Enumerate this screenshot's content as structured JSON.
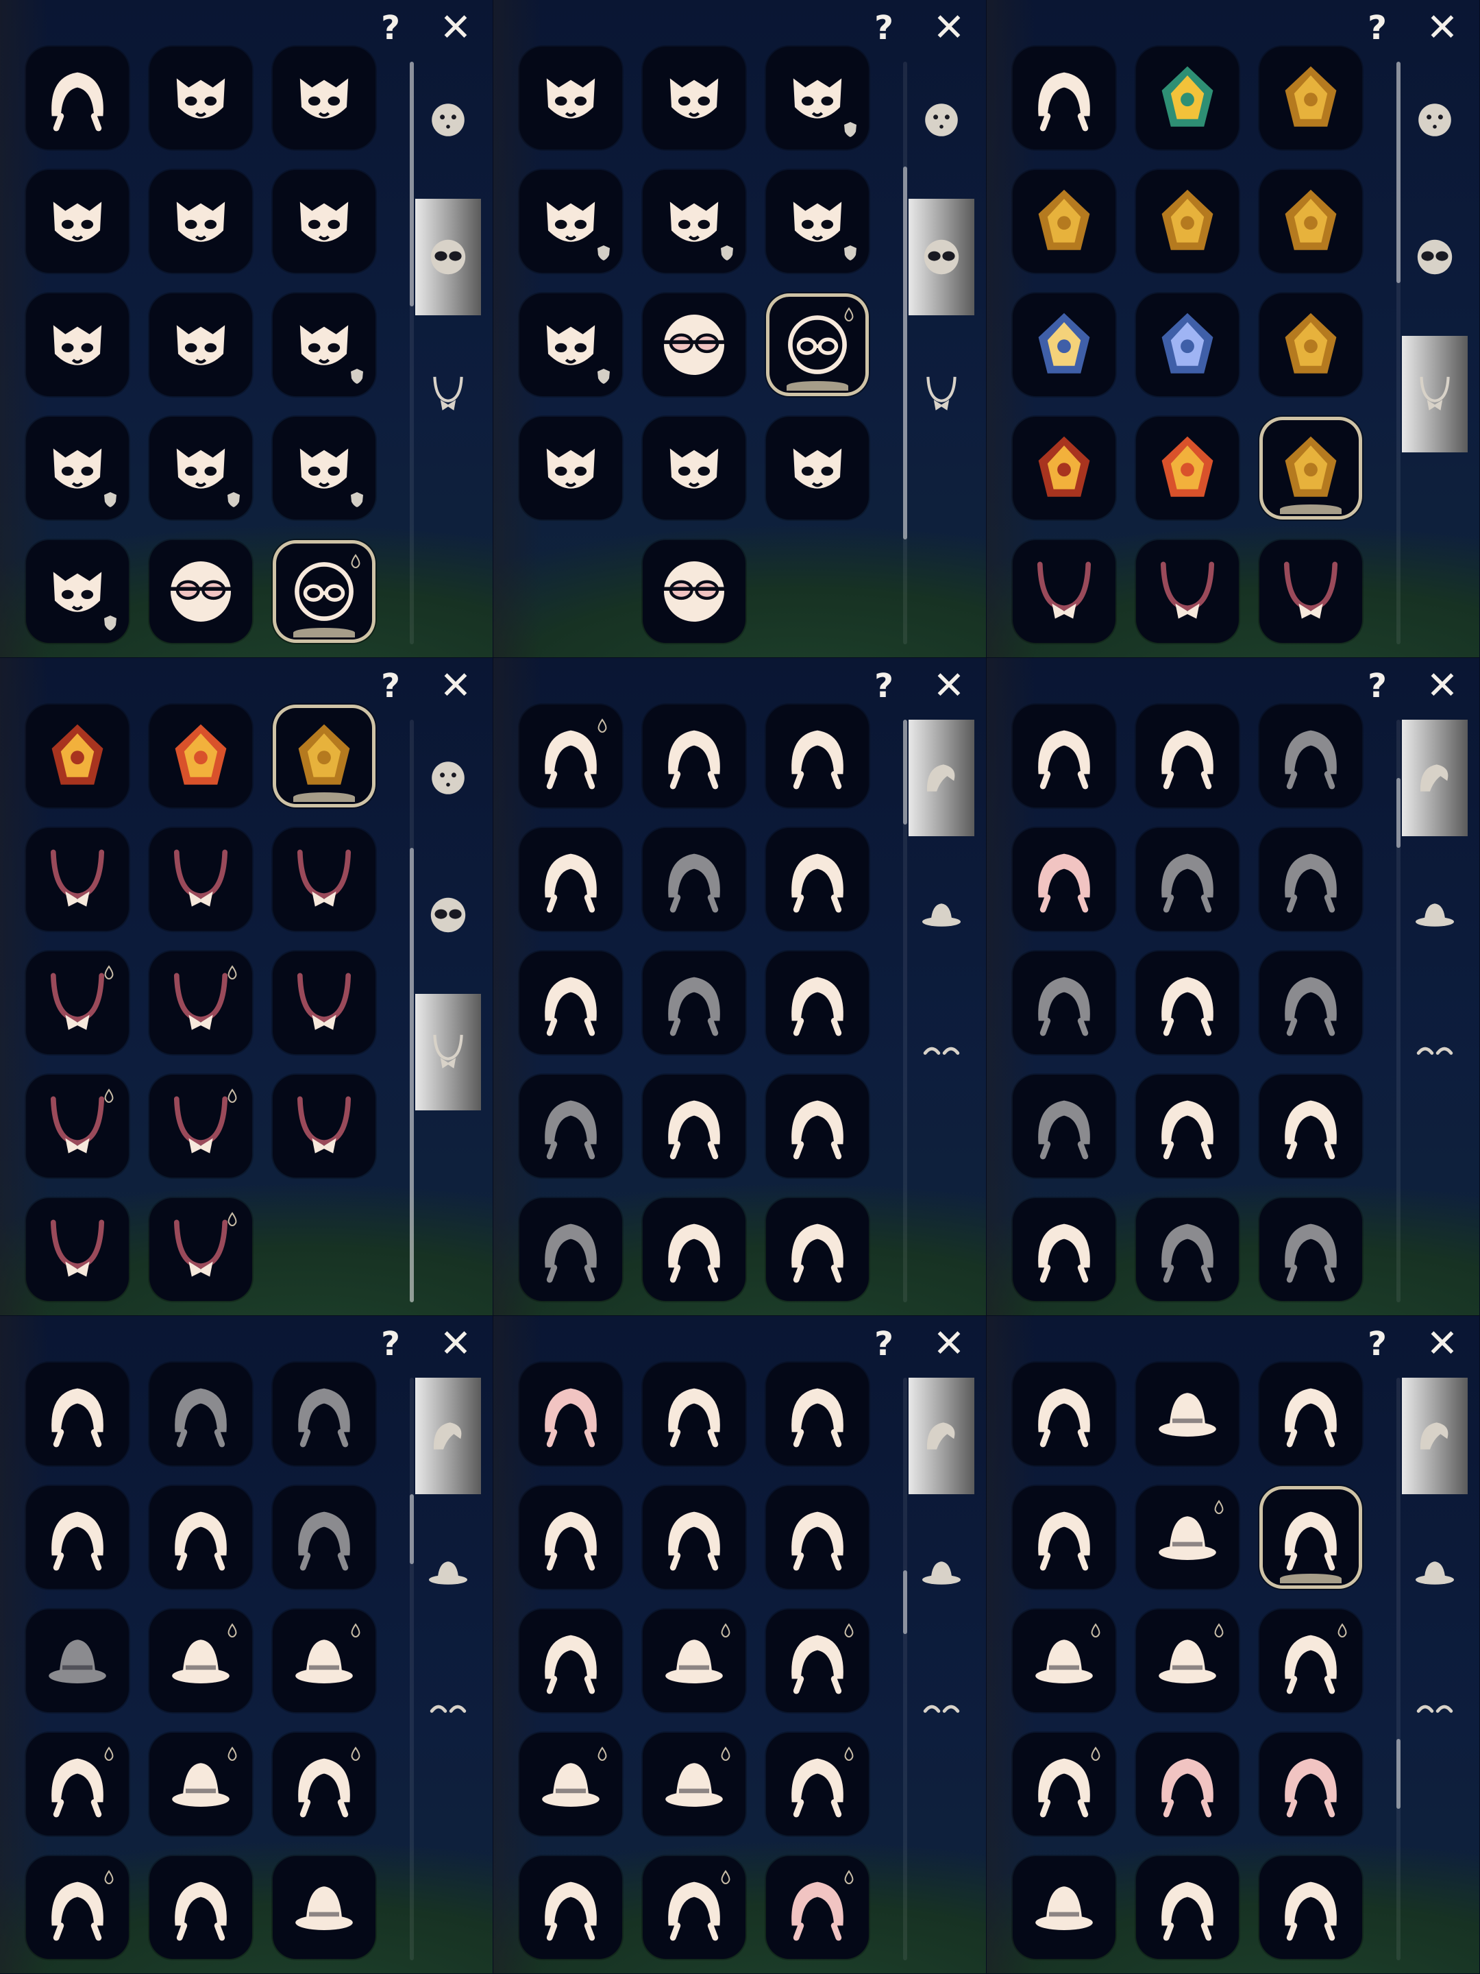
{
  "ui": {
    "help_label": "?",
    "close_label": "✕"
  },
  "colors": {
    "cream": "#f7e9dc",
    "pink": "#f1c4c2",
    "dark_pink": "#9a4a5a",
    "gray": "#8b8b8f",
    "gold": "#e7b23c",
    "gold_dark": "#b57a1f",
    "blue": "#3f5fa8",
    "red": "#a8341f",
    "cell_bg": "#040817",
    "selected_border": "#cfc3a6"
  },
  "panels": [
    {
      "id": "masks-1",
      "tabs": [
        "face-tab-icon",
        "mask-tab-icon",
        "necklace-tab-icon"
      ],
      "active_tab": 1,
      "scroll": [
        0.0,
        0.42
      ],
      "cells": [
        [
          "none-icon",
          "bull-mask-icon",
          "helmet-mask-icon"
        ],
        [
          "diamond-mask-icon",
          "horned-mask-icon",
          "horned-mask-icon"
        ],
        [
          "wolf-mask-icon",
          "helmet-mask-icon",
          "bull-mask-icon:locked"
        ],
        [
          "crown-mask-icon:locked",
          "diamond-mask-icon:locked",
          "spirit-mask-icon:locked"
        ],
        [
          "spirit-mask-icon:locked",
          "sunglasses-icon",
          "glasses-icon:selected:drop"
        ]
      ]
    },
    {
      "id": "masks-2",
      "tabs": [
        "face-tab-icon",
        "mask-tab-icon",
        "necklace-tab-icon"
      ],
      "active_tab": 1,
      "scroll": [
        0.18,
        0.82
      ],
      "cells": [
        [
          "wolf-mask-icon",
          "helmet-mask-icon",
          "bull-mask-icon:locked"
        ],
        [
          "crown-mask-icon:locked",
          "diamond-mask-icon:locked",
          "spirit-mask-icon:locked"
        ],
        [
          "spirit-mask-icon:locked",
          "sunglasses-icon",
          "glasses-icon:selected:drop"
        ],
        [
          "fox-mask-icon",
          "beard-mask-icon",
          "swirl-mask-icon"
        ],
        [
          "",
          "heart-glasses-icon",
          ""
        ]
      ]
    },
    {
      "id": "necklaces-1",
      "tabs": [
        "face-tab-icon",
        "mask-tab-icon",
        "necklace-tab-icon"
      ],
      "active_tab": 2,
      "scroll": [
        0.0,
        0.38
      ],
      "cells": [
        [
          "none-icon",
          "aquatic-crest-icon",
          "whirl-crest-icon"
        ],
        [
          "arch-crest-icon",
          "crystal-crest-icon",
          "wings-crest-icon"
        ],
        [
          "gem-crest-icon",
          "star-crest-icon",
          "mountain-crest-icon"
        ],
        [
          "flame-crest-icon",
          "bird-crest-icon",
          "sun-gear-crest-icon:selected"
        ],
        [
          "bow-necklace-icon",
          "tie-necklace-icon",
          "fish-necklace-icon"
        ]
      ]
    },
    {
      "id": "necklaces-2",
      "tabs": [
        "face-tab-icon",
        "mask-tab-icon",
        "necklace-tab-icon"
      ],
      "active_tab": 2,
      "scroll": [
        0.22,
        1.0
      ],
      "cells": [
        [
          "flame-crest-icon",
          "bird-crest-icon",
          "sun-gear-crest-icon:selected"
        ],
        [
          "bow-necklace-icon",
          "tie-necklace-icon",
          "fish-necklace-icon"
        ],
        [
          "scarf-necklace-icon:drop",
          "strap-necklace-icon:drop",
          "ruff-necklace-icon"
        ],
        [
          "bib-necklace-icon:drop",
          "flower-necklace-icon:drop",
          "turtle-necklace-icon"
        ],
        [
          "bell-necklace-icon",
          "pouch-necklace-icon:drop",
          ""
        ]
      ]
    },
    {
      "id": "hair-1",
      "tabs": [
        "hair-tab-icon",
        "hat-tab-icon",
        "horn-tab-icon"
      ],
      "active_tab": 0,
      "scroll": [
        0.0,
        0.18
      ],
      "cells": [
        [
          "ponytail-hair-icon:drop",
          "short-hair-icon",
          "pigtail-hair-icon"
        ],
        [
          "bun-hair-icon",
          "side-swept-hair-icon:gray",
          "bob-hair-icon"
        ],
        [
          "buns-hair-icon",
          "buns-hair-icon:gray",
          "bald-hair-icon"
        ],
        [
          "side-hair-icon:gray",
          "quiff-hair-icon",
          "spiky-hair-icon"
        ],
        [
          "long-hair-icon:gray",
          "braid-hair-icon",
          "bob-hair-icon"
        ]
      ]
    },
    {
      "id": "hair-2",
      "tabs": [
        "hair-tab-icon",
        "hat-tab-icon",
        "horn-tab-icon"
      ],
      "active_tab": 0,
      "scroll": [
        0.1,
        0.22
      ],
      "cells": [
        [
          "bowl-hair-icon",
          "long-straight-hair-icon",
          "spiky-hair-icon:gray"
        ],
        [
          "bowl-hair-icon:pink",
          "side-hair-icon:gray",
          "side-swept-hair-icon:gray"
        ],
        [
          "curly-hair-icon:gray",
          "long-hair-icon",
          "bowl-hair-icon:gray"
        ],
        [
          "long-hair-icon:gray",
          "spiky-hair-icon",
          "afro-hair-icon"
        ],
        [
          "afro-hair-icon",
          "bun-hair-icon:gray",
          "buns-hair-icon:gray"
        ]
      ]
    },
    {
      "id": "hair-3",
      "tabs": [
        "hair-tab-icon",
        "hat-tab-icon",
        "horn-tab-icon"
      ],
      "active_tab": 0,
      "scroll": [
        0.2,
        0.32
      ],
      "cells": [
        [
          "egg-hair-icon",
          "wing-hair-icon:gray",
          "long-hair-icon:gray"
        ],
        [
          "fish-hair-icon",
          "bob-hair-icon",
          "spiky-hair-icon:gray"
        ],
        [
          "hood-hair-icon:gray",
          "cone-hat-icon:drop",
          "saturn-hat-icon:drop"
        ],
        [
          "spiky-hair-icon:drop",
          "saucer-hat-icon:drop",
          "buns-hair-icon:drop"
        ],
        [
          "bob-hair-icon:drop",
          "braid-hair-icon",
          "turban-hat-icon"
        ]
      ]
    },
    {
      "id": "hair-4",
      "tabs": [
        "hair-tab-icon",
        "hat-tab-icon",
        "horn-tab-icon"
      ],
      "active_tab": 0,
      "scroll": [
        0.33,
        0.44
      ],
      "cells": [
        [
          "pigtail-hair-icon:pink",
          "long-hair-icon",
          "long-hair-icon"
        ],
        [
          "curly-hair-icon",
          "bowl-hair-icon",
          "ponytail-hair-icon"
        ],
        [
          "bob-hair-icon",
          "wide-brim-hat-icon:drop",
          "ponytail-hair-icon:drop"
        ],
        [
          "saucer-hat-icon:drop",
          "flower-crown-icon:drop",
          "palm-hair-icon:drop"
        ],
        [
          "short-hair-icon",
          "braid-hair-icon:drop",
          "bob-hair-icon:pink:drop"
        ]
      ]
    },
    {
      "id": "hair-5",
      "tabs": [
        "hair-tab-icon",
        "hat-tab-icon",
        "horn-tab-icon"
      ],
      "active_tab": 0,
      "scroll": [
        0.62,
        0.74
      ],
      "cells": [
        [
          "long-hair-icon",
          "captain-hat-icon",
          "braid-hair-icon"
        ],
        [
          "braid-hair-icon",
          "bell-hat-icon:drop",
          "horned-hair-icon:selected"
        ],
        [
          "hood-hair-icon:drop",
          "bear-hood-icon:drop",
          "long-hair-icon:drop"
        ],
        [
          "curly-hair-icon:drop",
          "long-hair-icon:pink",
          "long-hair-icon:pink"
        ],
        [
          "crown-hair-icon",
          "braid-hair-icon",
          "pigtail-hair-icon"
        ]
      ]
    }
  ]
}
